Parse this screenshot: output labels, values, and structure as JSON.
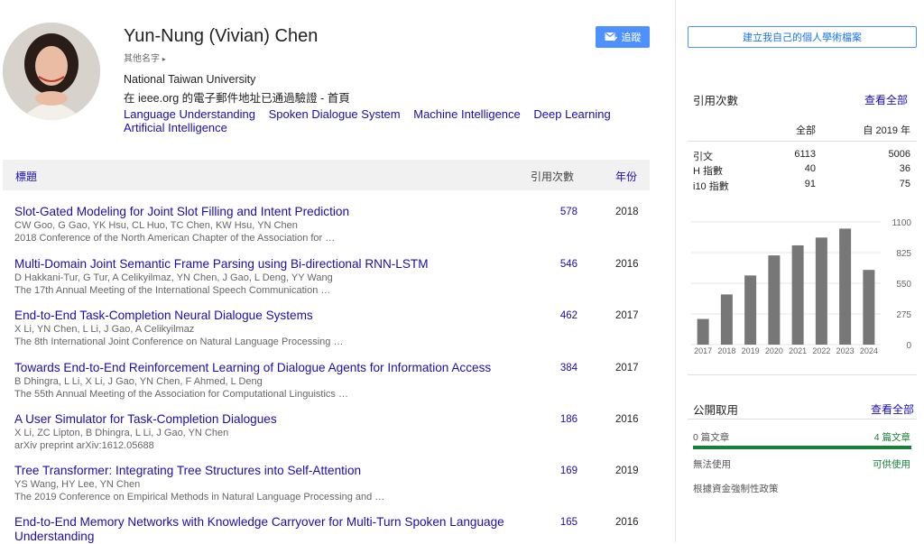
{
  "profile": {
    "name": "Yun-Nung (Vivian) Chen",
    "other_names": "其他名字",
    "affiliation": "National Taiwan University",
    "verified_prefix": "在 ieee.org 的電子郵件地址已通過驗證 - ",
    "homepage": "首頁",
    "interests": [
      "Language Understanding",
      "Spoken Dialogue System",
      "Machine Intelligence",
      "Deep Learning",
      "Artificial Intelligence"
    ],
    "follow_label": "追蹤"
  },
  "table": {
    "col_title": "標題",
    "col_cited": "引用次數",
    "col_year": "年份",
    "rows": [
      {
        "title": "Slot-Gated Modeling for Joint Slot Filling and Intent Prediction",
        "authors": "CW Goo, G Gao, YK Hsu, CL Huo, TC Chen, KW Hsu, YN Chen",
        "venue": "2018 Conference of the North American Chapter of the Association for …",
        "cited": "578",
        "year": "2018"
      },
      {
        "title": "Multi-Domain Joint Semantic Frame Parsing using Bi-directional RNN-LSTM",
        "authors": "D Hakkani-Tur, G Tur, A Celikyilmaz, YN Chen, J Gao, L Deng, YY Wang",
        "venue": "The 17th Annual Meeting of the International Speech Communication …",
        "cited": "546",
        "year": "2016"
      },
      {
        "title": "End-to-End Task-Completion Neural Dialogue Systems",
        "authors": "X Li, YN Chen, L Li, J Gao, A Celikyilmaz",
        "venue": "The 8th International Joint Conference on Natural Language Processing …",
        "cited": "462",
        "year": "2017"
      },
      {
        "title": "Towards End-to-End Reinforcement Learning of Dialogue Agents for Information Access",
        "authors": "B Dhingra, L Li, X Li, J Gao, YN Chen, F Ahmed, L Deng",
        "venue": "The 55th Annual Meeting of the Association for Computational Linguistics …",
        "cited": "384",
        "year": "2017"
      },
      {
        "title": "A User Simulator for Task-Completion Dialogues",
        "authors": "X Li, ZC Lipton, B Dhingra, L Li, J Gao, YN Chen",
        "venue": "arXiv preprint arXiv:1612.05688",
        "cited": "186",
        "year": "2016"
      },
      {
        "title": "Tree Transformer: Integrating Tree Structures into Self-Attention",
        "authors": "YS Wang, HY Lee, YN Chen",
        "venue": "The 2019 Conference on Empirical Methods in Natural Language Processing and …",
        "cited": "169",
        "year": "2019"
      },
      {
        "title": "End-to-End Memory Networks with Knowledge Carryover for Multi-Turn Spoken Language Understanding",
        "authors": "",
        "venue": "",
        "cited": "165",
        "year": "2016"
      }
    ]
  },
  "sidebar": {
    "create_profile": "建立我自己的個人學術檔案",
    "cited_by": {
      "heading": "引用次數",
      "view_all": "查看全部",
      "col_all": "全部",
      "col_since": "自 2019 年",
      "rows": [
        {
          "label": "引文",
          "all": "6113",
          "since": "5006"
        },
        {
          "label": "H 指數",
          "all": "40",
          "since": "36"
        },
        {
          "label": "i10 指數",
          "all": "91",
          "since": "75"
        }
      ]
    },
    "public_access": {
      "heading": "公開取用",
      "view_all": "查看全部",
      "left_count": "0 篇文章",
      "right_count": "4 篇文章",
      "left_label": "無法使用",
      "right_label": "可供使用",
      "mandates": "根據資金強制性政策"
    }
  },
  "chart_data": {
    "type": "bar",
    "categories": [
      "2017",
      "2018",
      "2019",
      "2020",
      "2021",
      "2022",
      "2023",
      "2024"
    ],
    "values": [
      230,
      450,
      620,
      800,
      890,
      960,
      1040,
      670
    ],
    "y_ticks": [
      0,
      275,
      550,
      825,
      1100
    ],
    "ylim": [
      0,
      1100
    ],
    "bar_color": "#777777"
  }
}
